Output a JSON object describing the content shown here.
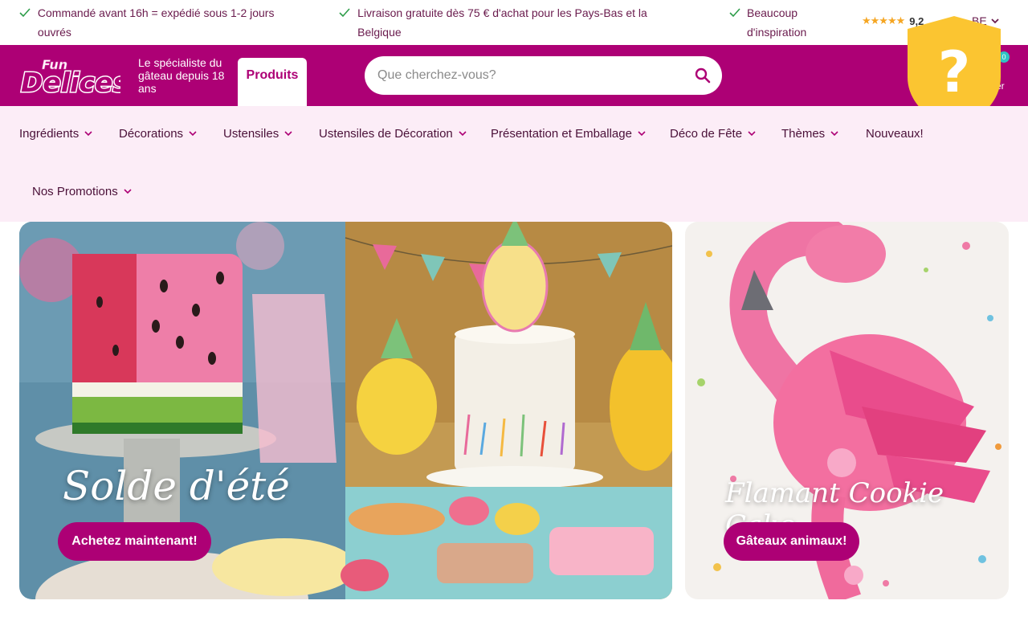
{
  "usp": [
    {
      "text": "Commandé avant 16h = expédié sous 1-2 jours ouvrés"
    },
    {
      "text": "Livraison gratuite dès 75 € d'achat pour les Pays-Bas et la Belgique"
    },
    {
      "text": "Beaucoup d'inspiration"
    }
  ],
  "rating": {
    "stars": "★★★★★",
    "score": "9,2"
  },
  "country": {
    "code": "BE"
  },
  "header": {
    "logo_text": "Fun Delices",
    "tagline": "Le spécialiste du gâteau depuis 18 ans",
    "products_tab": "Produits",
    "search_placeholder": "Que cherchez-vous?",
    "cart_count": "0",
    "cart_label": "er"
  },
  "nav": {
    "items": [
      {
        "label": "Ingrédients"
      },
      {
        "label": "Décorations"
      },
      {
        "label": "Ustensiles"
      },
      {
        "label": "Ustensiles de Décoration"
      },
      {
        "label": "Présentation et Emballage"
      },
      {
        "label": "Déco de Fête"
      },
      {
        "label": "Thèmes"
      },
      {
        "label": "Nouveaux!"
      },
      {
        "label": "Nos Promotions"
      }
    ]
  },
  "banners": [
    {
      "title": "Solde d'été",
      "cta": "Achetez maintenant!"
    },
    {
      "title": "Flamant Cookie Cake",
      "cta": "Gâteaux animaux!"
    }
  ],
  "colors": {
    "brand": "#ad0075",
    "nav_bg": "#fcedf7",
    "check": "#2e9d4a",
    "badge": "#fbc531"
  },
  "icons": [
    "check-icon",
    "star-icon",
    "chevron-down-icon",
    "search-icon",
    "help-icon"
  ]
}
